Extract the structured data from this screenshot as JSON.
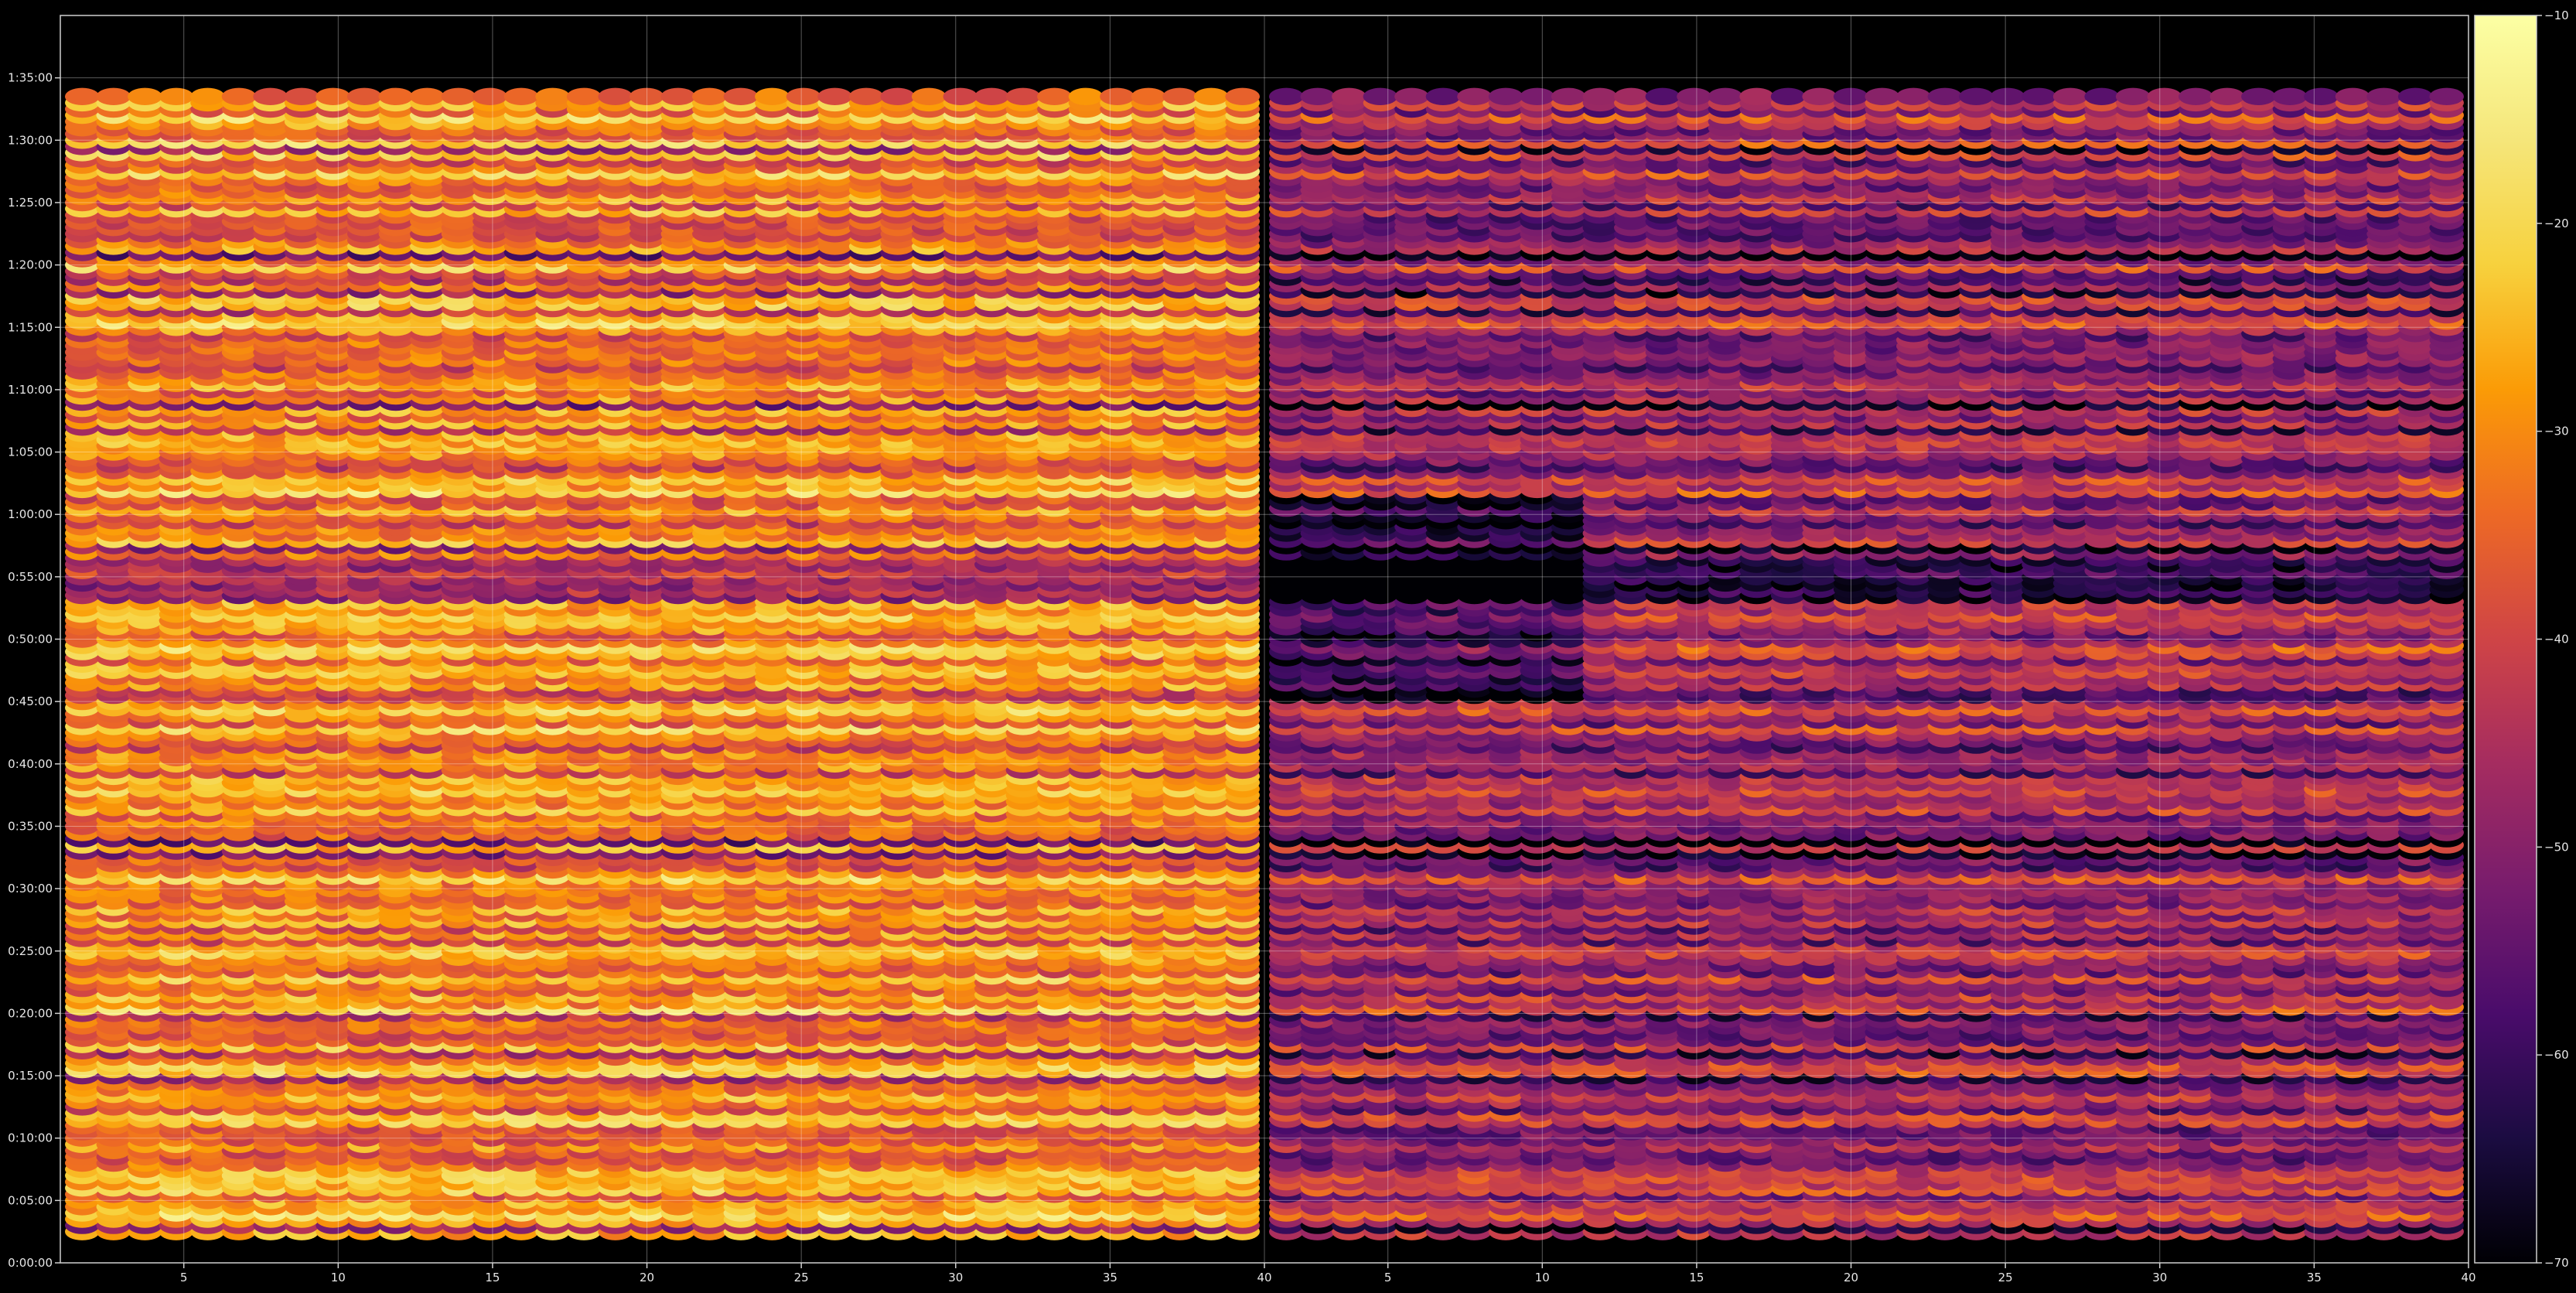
{
  "chart_data": {
    "type": "heatmap",
    "title": "",
    "xlabel": "",
    "ylabel": "",
    "panels": [
      {
        "name": "",
        "x_range": [
          1,
          40
        ],
        "x_ticks": [
          5,
          10,
          15,
          20,
          25,
          30,
          35,
          40
        ],
        "x_tick_labels": [
          "5",
          "10",
          "15",
          "20",
          "25",
          "30",
          "35",
          "40"
        ],
        "mean_level": "high"
      },
      {
        "name": "",
        "x_range": [
          40,
          79
        ],
        "x_ticks": [
          44,
          49,
          54,
          59,
          64,
          69,
          74,
          79
        ],
        "x_tick_labels": [
          "5",
          "10",
          "15",
          "20",
          "25",
          "30",
          "35",
          "40"
        ],
        "mean_level": "low"
      }
    ],
    "y_axis": {
      "type": "time",
      "range": [
        "0:00:00",
        "1:40:00"
      ],
      "ticks": [
        "0:00:00",
        "0:05:00",
        "0:10:00",
        "0:15:00",
        "0:20:00",
        "0:25:00",
        "0:30:00",
        "0:35:00",
        "0:40:00",
        "0:45:00",
        "0:50:00",
        "0:55:00",
        "1:00:00",
        "1:05:00",
        "1:10:00",
        "1:15:00",
        "1:20:00",
        "1:25:00",
        "1:30:00",
        "1:35:00"
      ]
    },
    "colorbar": {
      "colormap": "inferno",
      "range": [
        -70,
        -10
      ],
      "ticks": [
        -70,
        -60,
        -50,
        -40,
        -30,
        -20,
        -10
      ],
      "tick_labels": [
        "−70",
        "−60",
        "−50",
        "−40",
        "−30",
        "−20",
        "−10"
      ]
    },
    "grid": true,
    "background": "#000000"
  }
}
